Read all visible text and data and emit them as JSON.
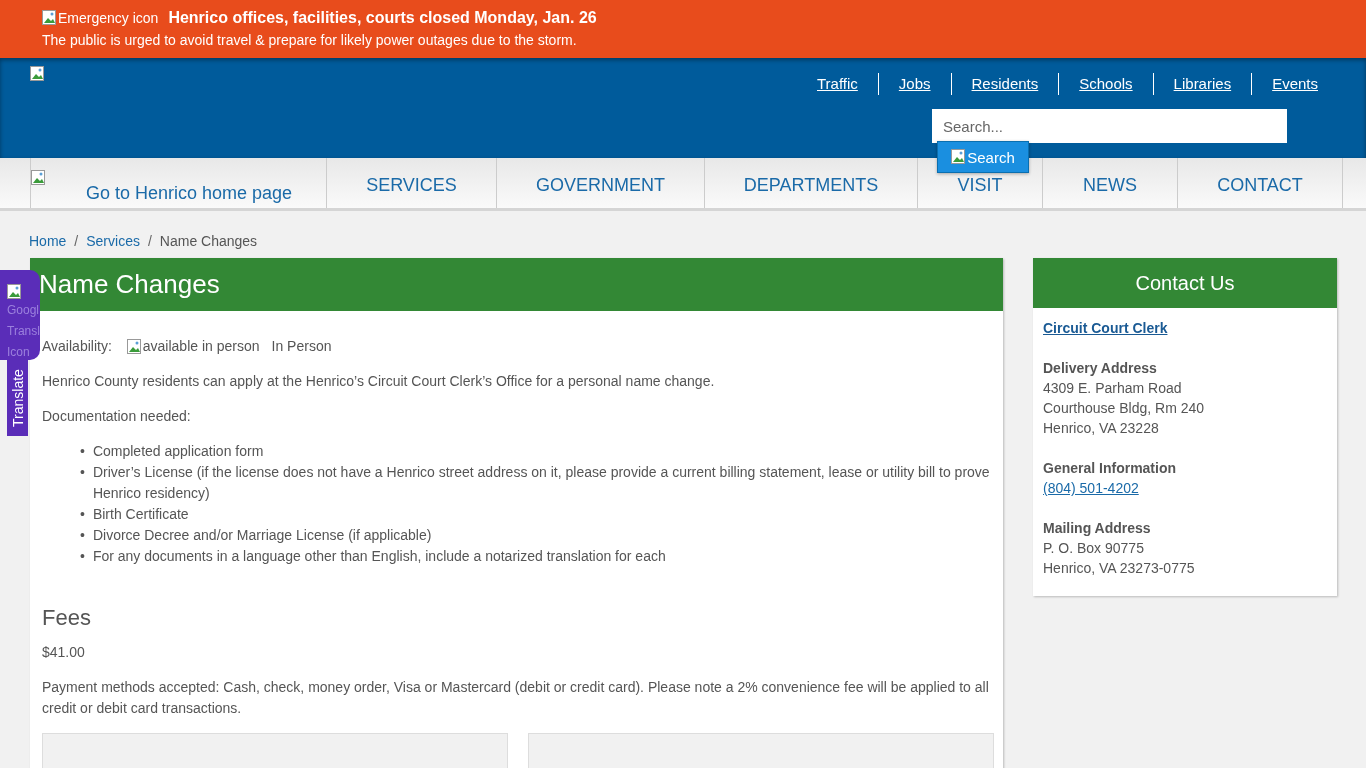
{
  "alert": {
    "icon_alt": "Emergency icon",
    "title": "Henrico offices, facilities, courts closed Monday, Jan. 26",
    "message": "The public is urged to avoid travel & prepare for likely power outages due to the storm."
  },
  "header": {
    "links": [
      "Traffic",
      "Jobs",
      "Residents",
      "Schools",
      "Libraries",
      "Events"
    ],
    "search": {
      "placeholder": "Search...",
      "button": "Search"
    }
  },
  "nav": {
    "home_alt": "Go to Henrico home page",
    "items": [
      "SERVICES",
      "GOVERNMENT",
      "DEPARTMENTS",
      "VISIT",
      "NEWS",
      "CONTACT"
    ]
  },
  "translate": {
    "icon_alt": [
      "Googl",
      "Transl",
      "Icon"
    ],
    "label": "Translate"
  },
  "breadcrumb": {
    "links": [
      "Home",
      "Services"
    ],
    "separator": "/",
    "current": "Name Changes"
  },
  "main": {
    "title": "Name Changes",
    "availability_label": "Availability:",
    "availability_alt": "available in person",
    "availability_value": "In Person",
    "intro": "Henrico County residents can apply at the Henrico’s Circuit Court Clerk’s Office for a personal name change.",
    "docs_label": "Documentation needed:",
    "bullet": "•",
    "docs": [
      "Completed application form",
      "Driver’s License (if the license does not have a Henrico street address on it, please provide a current billing statement, lease or utility bill to prove Henrico residency)",
      "Birth Certificate",
      "Divorce Decree and/or Marriage License (if applicable)",
      "For any documents in a language other than English, include a notarized translation for each"
    ],
    "fees_heading": "Fees",
    "fee": "$41.00",
    "payment": "Payment methods accepted: Cash, check, money order, Visa or Mastercard (debit or credit card). Please note a 2% convenience fee will be applied to all credit or debit card transactions."
  },
  "contact": {
    "title": "Contact Us",
    "office": "Circuit Court Clerk",
    "sections": [
      {
        "heading": "Delivery Address",
        "lines": [
          "4309 E. Parham Road",
          "Courthouse Bldg, Rm 240",
          "Henrico, VA 23228"
        ]
      },
      {
        "heading": "General Information",
        "phone": "(804) 501-4202"
      },
      {
        "heading": "Mailing Address",
        "lines": [
          "P. O. Box 90775",
          "Henrico, VA 23273-0775"
        ]
      }
    ]
  }
}
